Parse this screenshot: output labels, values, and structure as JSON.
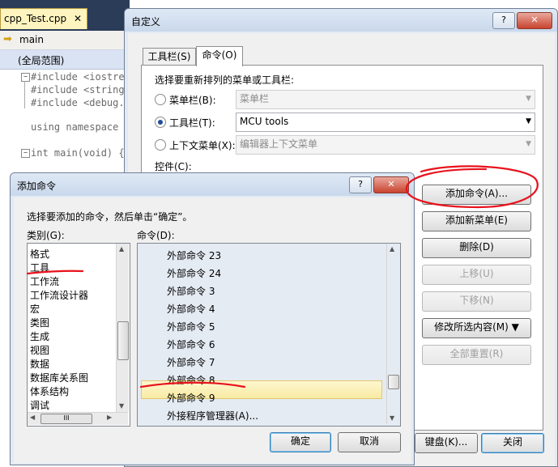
{
  "editor": {
    "file_tab": "cpp_Test.cpp",
    "file_tab_close": "✕",
    "function_nav": "main",
    "scope_nav": "(全局范围)",
    "code_lines": [
      "#include <iostrea",
      "#include <string.",
      "#include <debug.h",
      "",
      "using namespace s",
      "",
      "int main(void) {"
    ]
  },
  "customize": {
    "title": "自定义",
    "help": "?",
    "close": "✕",
    "tabs": [
      {
        "label": "工具栏(S)",
        "active": false
      },
      {
        "label": "命令(O)",
        "active": true
      }
    ],
    "prompt": "选择要重新排列的菜单或工具栏:",
    "menu_bar_label": "菜单栏(B):",
    "menu_bar_value": "菜单栏",
    "toolbar_label": "工具栏(T):",
    "toolbar_value": "MCU tools",
    "context_menu_label": "上下文菜单(X):",
    "context_menu_value": "编辑器上下文菜单",
    "selected_radio": "toolbar",
    "controls_label": "控件(C):",
    "buttons": {
      "add_command": "添加命令(A)...",
      "add_new_menu": "添加新菜单(E)",
      "delete": "删除(D)",
      "move_up": "上移(U)",
      "move_down": "下移(N)",
      "modify_selection": "修改所选内容(M) ▼",
      "reset_all": "全部重置(R)",
      "keyboard": "键盘(K)...",
      "close": "关闭"
    }
  },
  "add_command": {
    "title": "添加命令",
    "help": "?",
    "close": "✕",
    "instructions": "选择要添加的命令，然后单击“确定”。",
    "categories_label": "类别(G):",
    "commands_label": "命令(D):",
    "categories": [
      "格式",
      "工具",
      "工作流",
      "工作流设计器",
      "宏",
      "类图",
      "生成",
      "视图",
      "数据",
      "数据库关系图",
      "体系结构",
      "调试"
    ],
    "categories_hscroll_grip": "III",
    "commands": [
      "外部命令 23",
      "外部命令 24",
      "外部命令 3",
      "外部命令 4",
      "外部命令 5",
      "外部命令 6",
      "外部命令 7",
      "外部命令 8",
      "外部命令 9",
      "外接程序管理器(A)..."
    ],
    "selected_command": "外部命令 8",
    "ok": "确定",
    "cancel": "取消"
  },
  "colors": {
    "annotation_red": "#e8121c",
    "title_bar": "#c9d8ec",
    "editor_tab_bar": "#2b3c59"
  }
}
